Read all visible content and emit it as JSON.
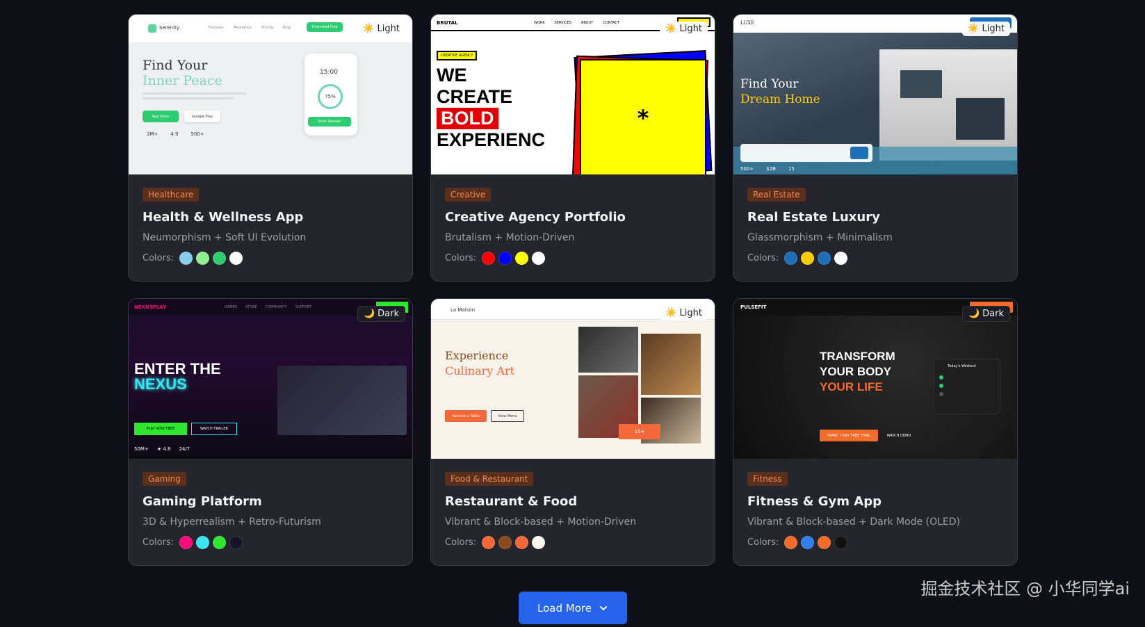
{
  "cards": [
    {
      "mode": "Light",
      "category": "Healthcare",
      "title": "Health & Wellness App",
      "style": "Neumorphism + Soft UI Evolution",
      "colors_label": "Colors:",
      "colors": [
        "#87ceeb",
        "#90ee90",
        "#2ecc71",
        "#ffffff"
      ],
      "preview": {
        "brand": "Serenity",
        "nav": [
          "Features",
          "Meditation",
          "Pricing",
          "Blog"
        ],
        "cta": "Download Free",
        "headline_1": "Find Your",
        "headline_2": "Inner Peace",
        "btn_primary": "App Store",
        "btn_secondary": "Google Play",
        "stats": [
          "2M+",
          "4.9",
          "500+"
        ],
        "timer": "15:00",
        "progress": "75%",
        "session_btn": "Start Session"
      }
    },
    {
      "mode": "Light",
      "category": "Creative",
      "title": "Creative Agency Portfolio",
      "style": "Brutalism + Motion-Driven",
      "colors_label": "Colors:",
      "colors": [
        "#ff0000",
        "#0000ff",
        "#ffff00",
        "#ffffff"
      ],
      "preview": {
        "brand": "BRUTAL",
        "nav": [
          "WORK",
          "SERVICES",
          "ABOUT",
          "CONTACT"
        ],
        "tag": "CREATIVE AGENCY",
        "line1": "WE",
        "line2": "CREATE",
        "line3": "BOLD",
        "line4": "EXPERIENC",
        "asterisk": "*"
      }
    },
    {
      "mode": "Light",
      "category": "Real Estate",
      "title": "Real Estate Luxury",
      "style": "Glassmorphism + Minimalism",
      "colors_label": "Colors:",
      "colors": [
        "#1e6fb8",
        "#ffcc00",
        "#1e6fb8",
        "#ffffff"
      ],
      "preview": {
        "brand": "LUXE",
        "headline_1": "Find Your",
        "headline_2": "Dream Home",
        "stats": [
          "500+",
          "$2B",
          "15"
        ]
      }
    },
    {
      "mode": "Dark",
      "category": "Gaming",
      "title": "Gaming Platform",
      "style": "3D & Hyperrealism + Retro-Futurism",
      "colors_label": "Colors:",
      "colors": [
        "#ff0a7a",
        "#39e6f0",
        "#2ee62e",
        "#141428"
      ],
      "preview": {
        "brand": "NEXUSPLAY",
        "nav": [
          "GAMES",
          "STORE",
          "COMMUNITY",
          "SUPPORT"
        ],
        "line1": "ENTER THE",
        "line2": "NEXUS",
        "btn_primary": "PLAY NOW FREE",
        "btn_secondary": "WATCH TRAILER",
        "stats": [
          "50M+",
          "★ 4.8",
          "24/7"
        ]
      }
    },
    {
      "mode": "Light",
      "category": "Food & Restaurant",
      "title": "Restaurant & Food",
      "style": "Vibrant & Block-based + Motion-Driven",
      "colors_label": "Colors:",
      "colors": [
        "#f4683a",
        "#8b4a1a",
        "#f4683a",
        "#fffaf0"
      ],
      "preview": {
        "brand": "La Maison",
        "line1": "Experience",
        "line2": "Culinary Art",
        "btn_primary": "Reserve a Table",
        "btn_secondary": "View Menu",
        "badge": "15+"
      }
    },
    {
      "mode": "Dark",
      "category": "Fitness",
      "title": "Fitness & Gym App",
      "style": "Vibrant & Block-based + Dark Mode (OLED)",
      "colors_label": "Colors:",
      "colors": [
        "#f46b2a",
        "#2f80ed",
        "#f46b2a",
        "#111111"
      ],
      "preview": {
        "brand": "PULSEFIT",
        "line1": "TRANSFORM",
        "line2": "YOUR BODY",
        "line3": "YOUR LIFE",
        "btn_primary": "START 7-DAY FREE TRIAL",
        "btn_secondary": "WATCH DEMO",
        "workout_title": "Today's Workout"
      }
    }
  ],
  "load_more": {
    "label": "Load More"
  },
  "watermark": "掘金技术社区 @ 小华同学ai"
}
